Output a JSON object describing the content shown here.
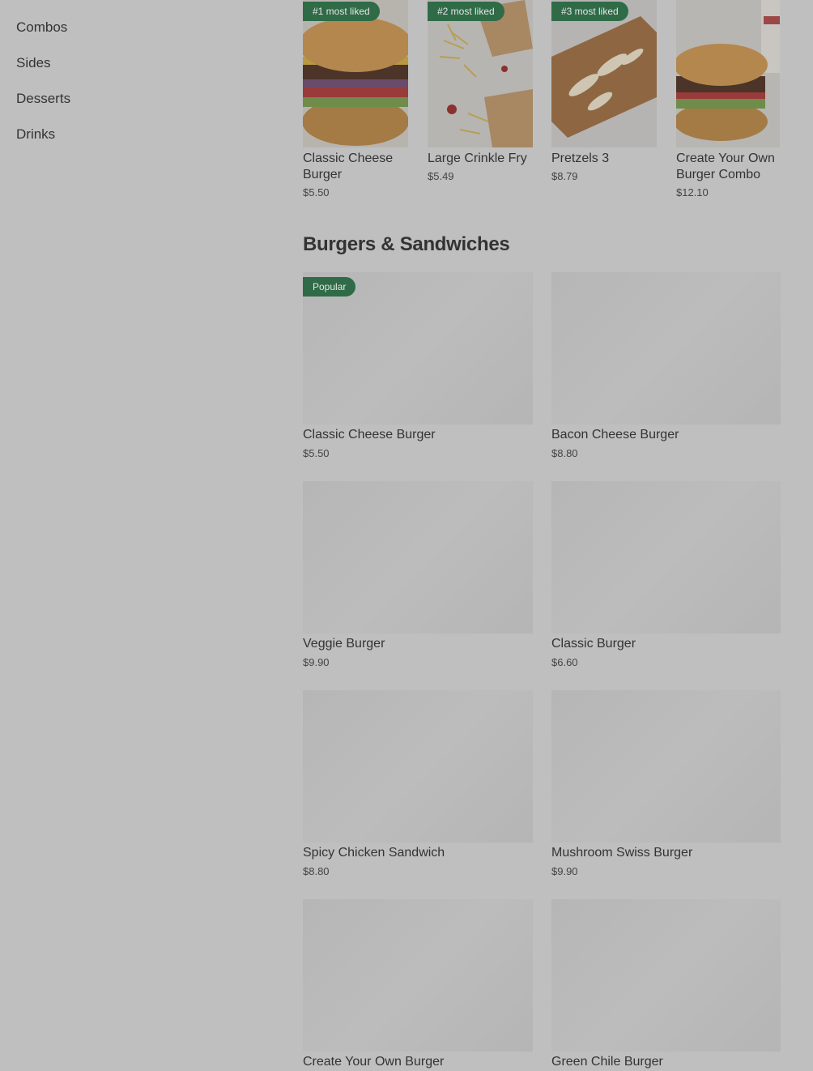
{
  "sidebar": {
    "items": [
      {
        "label": "Combos"
      },
      {
        "label": "Sides"
      },
      {
        "label": "Desserts"
      },
      {
        "label": "Drinks"
      }
    ]
  },
  "most_liked": [
    {
      "badge": "#1 most liked",
      "title": "Classic Cheese Burger",
      "price": "$5.50",
      "image": "cheeseburger-photo"
    },
    {
      "badge": "#2 most liked",
      "title": "Large Crinkle Fry",
      "price": "$5.49",
      "image": "fries-photo"
    },
    {
      "badge": "#3 most liked",
      "title": "Pretzels 3",
      "price": "$8.79",
      "image": "pretzel-photo"
    },
    {
      "badge": "",
      "title": "Create Your Own Burger Combo",
      "price": "$12.10",
      "image": "burger-combo-photo"
    }
  ],
  "section": {
    "title": "Burgers & Sandwiches",
    "popular_badge": "Popular",
    "items": [
      {
        "title": "Classic Cheese Burger",
        "price": "$5.50"
      },
      {
        "title": "Bacon Cheese Burger",
        "price": "$8.80"
      },
      {
        "title": "Veggie Burger",
        "price": "$9.90"
      },
      {
        "title": "Classic Burger",
        "price": "$6.60"
      },
      {
        "title": "Spicy Chicken Sandwich",
        "price": "$8.80"
      },
      {
        "title": "Mushroom Swiss Burger",
        "price": "$9.90"
      },
      {
        "title": "Create Your Own Burger",
        "price": ""
      },
      {
        "title": "Green Chile Burger",
        "price": ""
      }
    ]
  }
}
